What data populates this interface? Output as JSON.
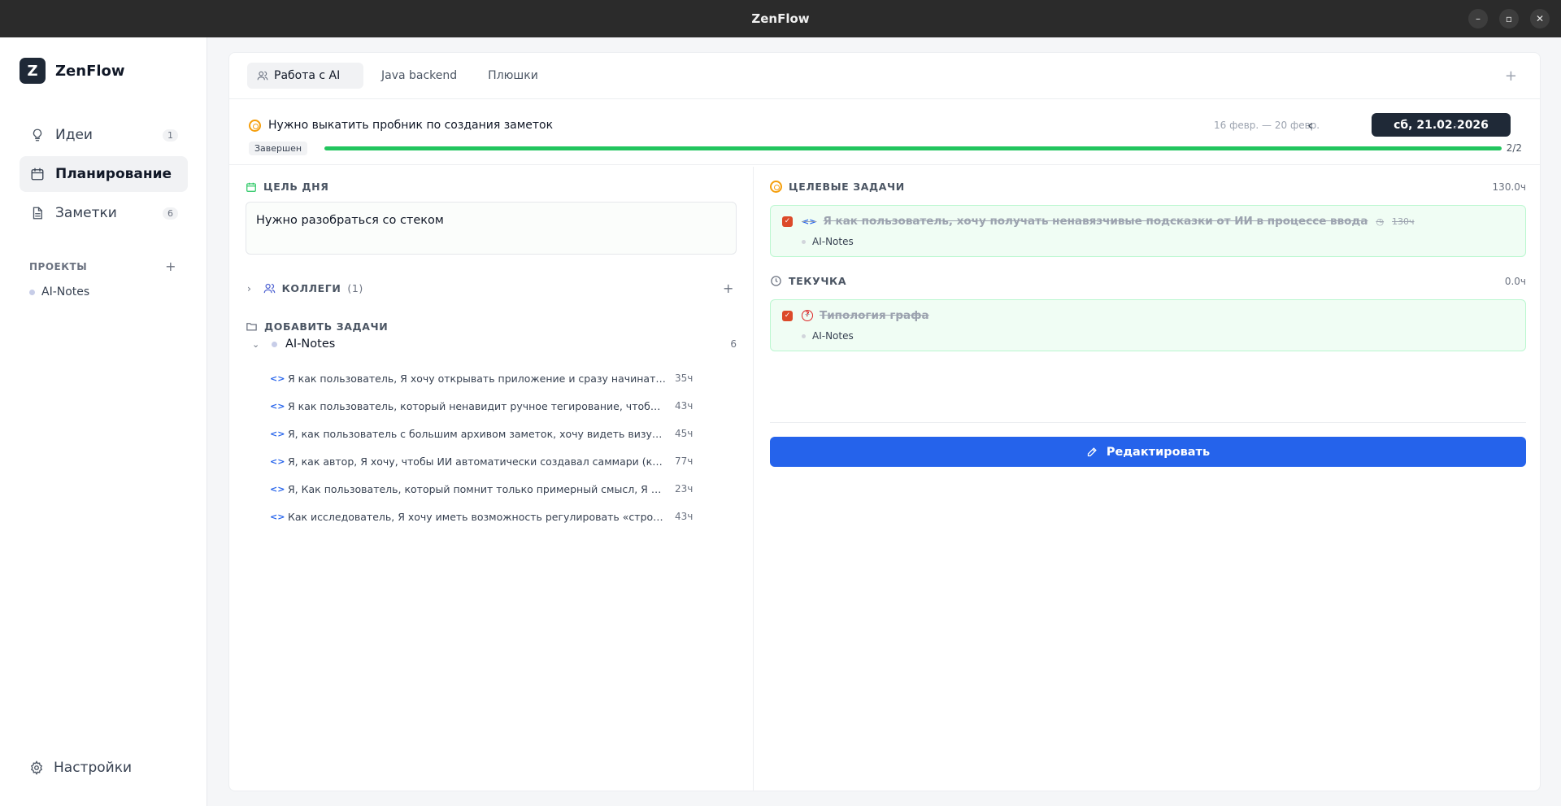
{
  "window": {
    "title": "ZenFlow"
  },
  "sidebar": {
    "brand": {
      "logo_letter": "Z",
      "name": "ZenFlow"
    },
    "nav": [
      {
        "label": "Идеи",
        "count": "1",
        "icon": "lightbulb-icon"
      },
      {
        "label": "Планирование",
        "count": "",
        "icon": "calendar-icon",
        "active": true
      },
      {
        "label": "Заметки",
        "count": "6",
        "icon": "document-icon"
      }
    ],
    "projects_label": "ПРОЕКТЫ",
    "projects": [
      {
        "name": "AI-Notes"
      }
    ],
    "settings_label": "Настройки"
  },
  "main": {
    "tabs": [
      {
        "label": "Работа с AI",
        "active": true
      },
      {
        "label": "Java backend"
      },
      {
        "label": "Плюшки"
      }
    ],
    "goal": {
      "title": "Нужно выкатить пробник по создания заметок",
      "date_range": "16 февр. — 20 февр.",
      "current_date": "сб, 21.02.2026",
      "status": "Завершен",
      "progress_fraction": 1.0,
      "progress_text": "2/2"
    },
    "day_goal": {
      "header": "ЦЕЛЬ ДНЯ",
      "text": "Нужно разобраться со стеком"
    },
    "colleagues": {
      "header": "КОЛЛЕГИ",
      "count": "(1)"
    },
    "add_tasks": {
      "header": "ДОБАВИТЬ ЗАДАЧИ",
      "group": {
        "name": "AI-Notes",
        "count": "6"
      },
      "tasks": [
        {
          "title": "Я как пользователь, Я хочу открывать приложение и сразу начинать писать, не задумываясь о структуре",
          "hours": "35ч"
        },
        {
          "title": "Я как пользователь, который ненавидит ручное тегирование, чтобы ИИ автоматически расставлял теги",
          "hours": "43ч"
        },
        {
          "title": "Я, как пользователь с большим архивом заметок, хочу видеть визуальный граф связей",
          "hours": "45ч"
        },
        {
          "title": "Я, как автор, Я хочу, чтобы ИИ автоматически создавал саммари (краткое содержание)",
          "hours": "77ч"
        },
        {
          "title": "Я, Как пользователь, который помнит только примерный смысл, Я хочу искать по смыслу",
          "hours": "23ч"
        },
        {
          "title": "Как исследователь, Я хочу иметь возможность регулировать «строгость» поиска",
          "hours": "43ч"
        }
      ]
    },
    "target_tasks": {
      "header": "ЦЕЛЕВЫЕ ЗАДАЧИ",
      "total": "130.0ч",
      "items": [
        {
          "title": "Я как пользователь, хочу получать ненавязчивые подсказки от ИИ в процессе ввода",
          "hours": "130ч",
          "project": "AI-Notes"
        }
      ]
    },
    "routine": {
      "header": "ТЕКУЧКА",
      "total": "0.0ч",
      "items": [
        {
          "title": "Типология графа",
          "project": "AI-Notes"
        }
      ]
    },
    "edit_label": "Редактировать"
  },
  "colors": {
    "accent": "#2563eb",
    "success": "#22c55e",
    "dark": "#1f2937"
  }
}
